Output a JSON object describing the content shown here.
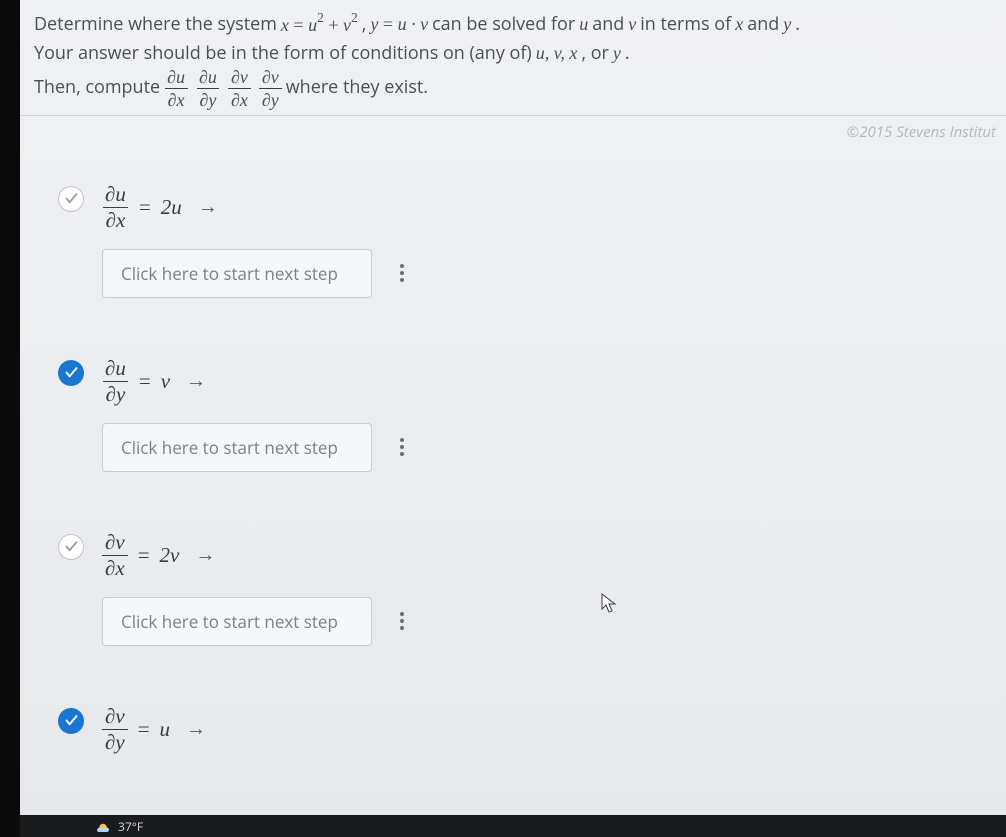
{
  "prompt": {
    "line1_prefix": "Determine where the system ",
    "eq1_lhs": "x",
    "eq1_rhs_a": "u",
    "eq1_rhs_b": "v",
    "eq1_exp": "2",
    "eq_comma": ", ",
    "eq2_lhs": "y",
    "eq2_rhs": "u · v",
    "line1_suffix": " can be solved for ",
    "u": "u",
    "and1": " and ",
    "v": "v",
    "line1_end": " in terms of ",
    "x": "x",
    "and2": " and ",
    "y": "y",
    "period": ".",
    "line2": "Your answer should be in the form of conditions on (any of) ",
    "line2_vars": "u, v, x",
    "line2_or": ", or ",
    "line2_y": "y",
    "line3_prefix": "Then, compute ",
    "line3_suffix": " where they exist.",
    "partials": [
      {
        "num": "∂u",
        "den": "∂x"
      },
      {
        "num": "∂u",
        "den": "∂y"
      },
      {
        "num": "∂v",
        "den": "∂x"
      },
      {
        "num": "∂v",
        "den": "∂y"
      }
    ]
  },
  "copyright": "©2015 Stevens Institut",
  "answers": [
    {
      "status": "pending",
      "frac_num": "∂u",
      "frac_den": "∂x",
      "eq": "=",
      "rhs": "2u"
    },
    {
      "status": "correct",
      "frac_num": "∂u",
      "frac_den": "∂y",
      "eq": "=",
      "rhs": "v"
    },
    {
      "status": "pending",
      "frac_num": "∂v",
      "frac_den": "∂x",
      "eq": "=",
      "rhs": "2v"
    },
    {
      "status": "correct",
      "frac_num": "∂v",
      "frac_den": "∂y",
      "eq": "=",
      "rhs": "u"
    }
  ],
  "next_step_label": "Click here to start next step",
  "arrow": "→",
  "comma_sep": " , ",
  "taskbar": {
    "temp": "37°F"
  }
}
